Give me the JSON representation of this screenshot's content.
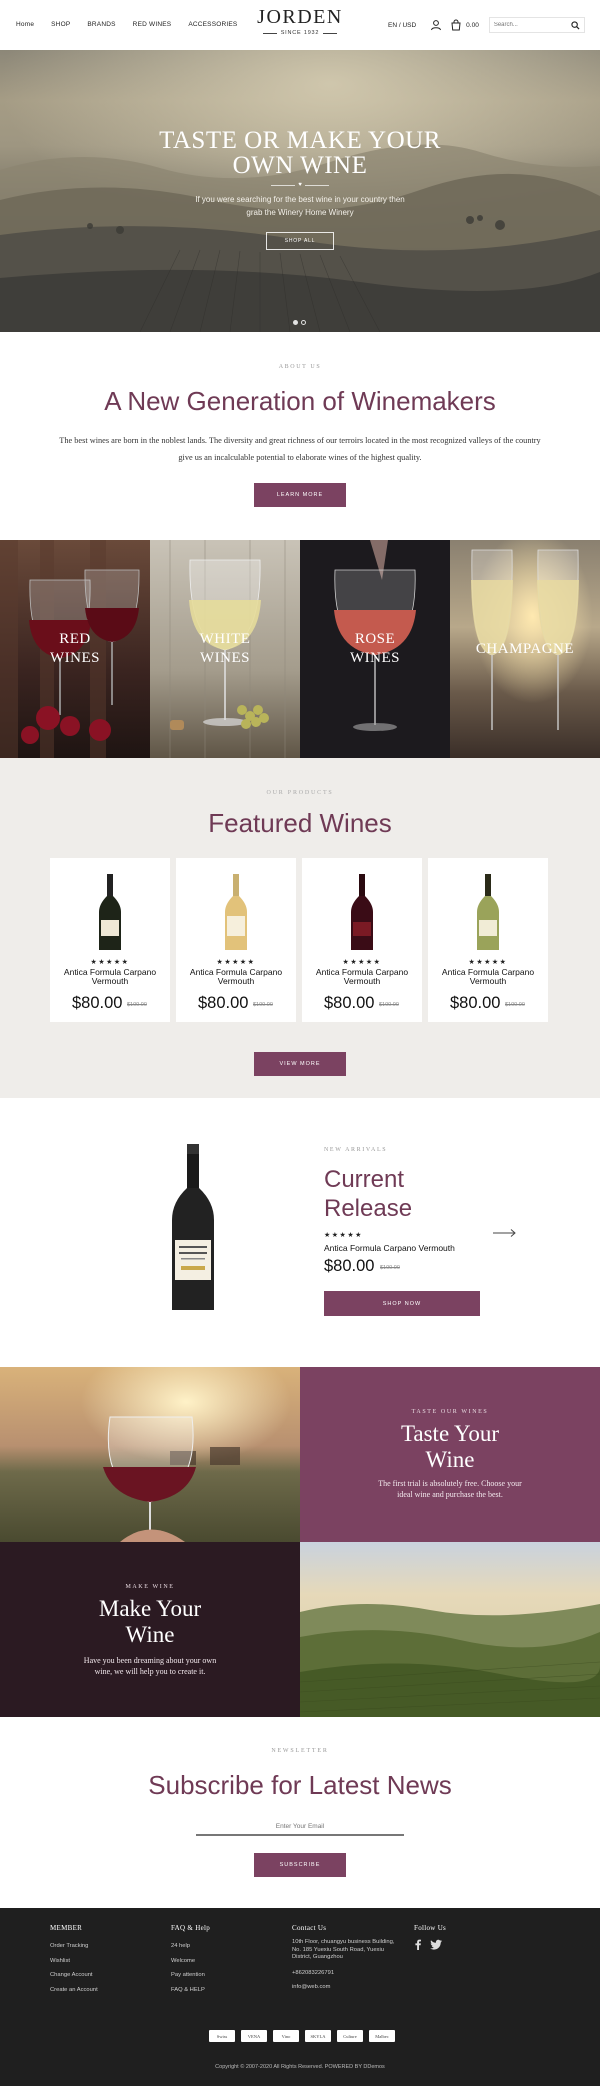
{
  "header": {
    "nav": [
      "Home",
      "SHOP",
      "BRANDS",
      "RED WINES",
      "ACCESSORIES"
    ],
    "logo": "JORDEN",
    "since": "SINCE 1932",
    "lang": "EN / USD",
    "cart_total": "0.00",
    "search_placeholder": "Search..."
  },
  "hero": {
    "title_line1": "TASTE OR MAKE YOUR",
    "title_line2": "OWN WINE",
    "text_line1": "If you were searching for the best wine in your country then",
    "text_line2": "grab the Winery Home Winery",
    "button": "SHOP ALL",
    "slide_index": 1,
    "slide_count": 2
  },
  "about": {
    "label": "ABOUT US",
    "title": "A New Generation of Winemakers",
    "text": "The best wines are born in the noblest lands. The diversity and great richness of our terroirs located in the most recognized valleys of the country give us an incalculable potential to elaborate wines of the highest quality.",
    "button": "LEARN MORE"
  },
  "categories": [
    {
      "line1": "RED",
      "line2": "WINES"
    },
    {
      "line1": "WHITE",
      "line2": "WINES"
    },
    {
      "line1": "ROSE",
      "line2": "WINES"
    },
    {
      "line1": "CHAMPAGNE",
      "line2": ""
    }
  ],
  "featured": {
    "label": "OUR PRODUCTS",
    "title": "Featured Wines",
    "button": "VIEW MORE",
    "products": [
      {
        "stars": "★★★★★",
        "name": "Antica Formula Carpano Vermouth",
        "price": "$80.00",
        "old_price": "$100.00"
      },
      {
        "stars": "★★★★★",
        "name": "Antica Formula Carpano Vermouth",
        "price": "$80.00",
        "old_price": "$100.00"
      },
      {
        "stars": "★★★★★",
        "name": "Antica Formula Carpano Vermouth",
        "price": "$80.00",
        "old_price": "$100.00"
      },
      {
        "stars": "★★★★★",
        "name": "Antica Formula Carpano Vermouth",
        "price": "$80.00",
        "old_price": "$100.00"
      }
    ]
  },
  "current_release": {
    "label": "NEW ARRIVALS",
    "title": "Current Release",
    "stars": "★★★★★",
    "name": "Antica Formula Carpano Vermouth",
    "price": "$80.00",
    "old_price": "$100.00",
    "button": "SHOP NOW"
  },
  "taste": {
    "label": "TASTE OUR WINES",
    "title_line1": "Taste Your",
    "title_line2": "Wine",
    "text": "The first trial is absolutely free. Choose your ideal wine and purchase the best."
  },
  "make": {
    "label": "MAKE WINE",
    "title_line1": "Make Your",
    "title_line2": "Wine",
    "text": "Have you been dreaming about your own wine, we will help you to create it."
  },
  "newsletter": {
    "label": "NEWSLETTER",
    "title": "Subscribe for Latest News",
    "placeholder": "Enter Your Email",
    "button": "SUBSCRIBE"
  },
  "footer": {
    "member": {
      "title": "MEMBER",
      "links": [
        "Order Tracking",
        "Wishlist",
        "Change Account",
        "Create an Account"
      ]
    },
    "faq": {
      "title": "FAQ & Help",
      "links": [
        "24 help",
        "Welcome",
        "Pay attention",
        "FAQ & HELP"
      ]
    },
    "contact": {
      "title": "Contact Us",
      "address": "10th Floor, chuangyu business Building, No. 185 Yuexiu South Road, Yuexiu District, Guangzhou",
      "phone": "+862083226791",
      "email": "info@web.com"
    },
    "follow": {
      "title": "Follow Us"
    },
    "brand_logos": [
      "Swiss",
      "VENA",
      "Vino",
      "SKYLA",
      "Culture",
      "Malbec"
    ],
    "copyright": "Copyright © 2007-2020 All Rights Reserved. POWERED BY DDemos"
  },
  "colors": {
    "accent": "#7b4261",
    "heading": "#6f3a55",
    "footer": "#1f1f1f",
    "make_bg": "#2b1a22"
  }
}
